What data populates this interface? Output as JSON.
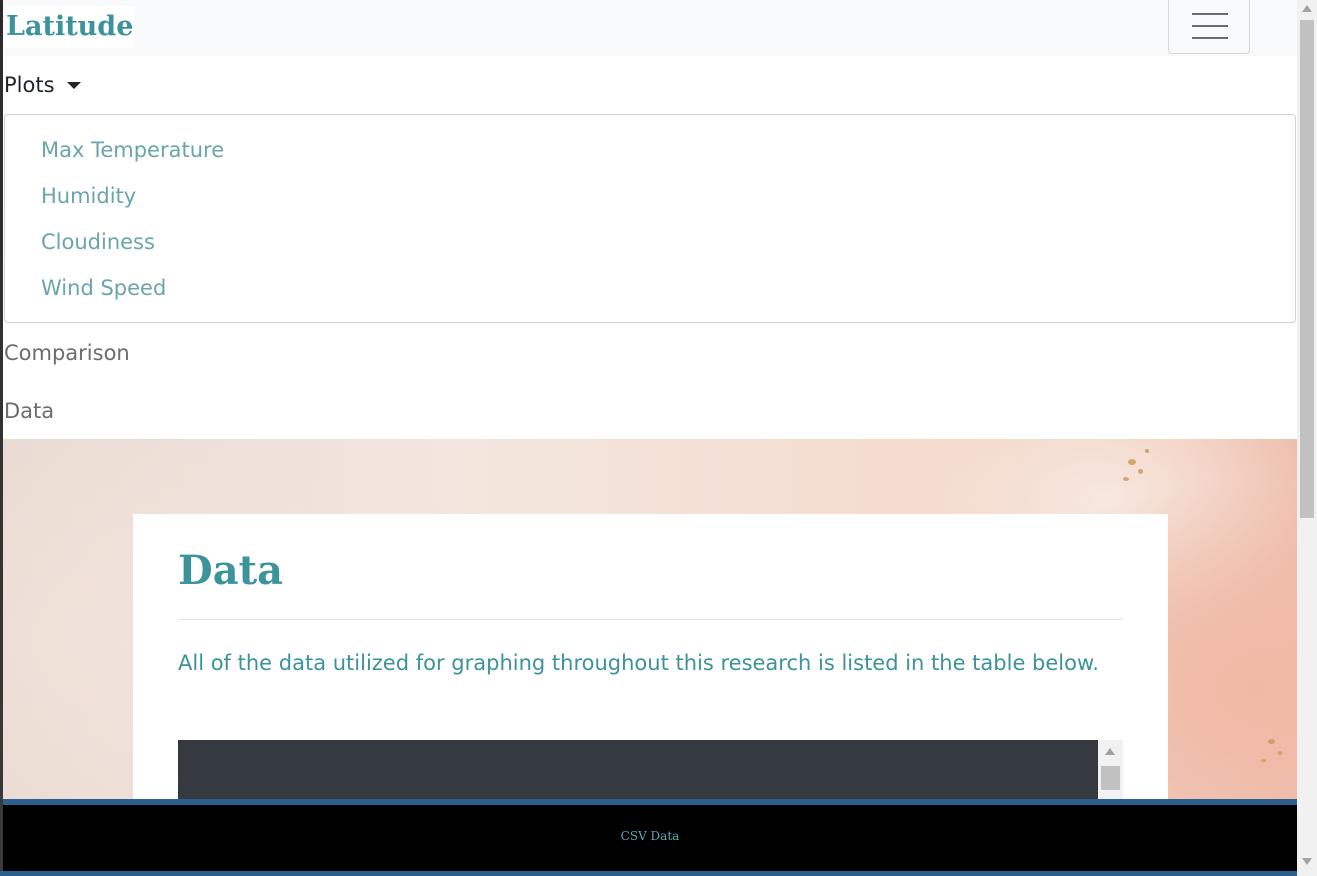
{
  "navbar": {
    "brand": "Latitude",
    "toggler_icon": "hamburger-menu-icon"
  },
  "nav": {
    "plots_label": "Plots",
    "plots_caret_icon": "caret-down-icon",
    "dropdown_items": [
      {
        "label": "Max Temperature"
      },
      {
        "label": "Humidity"
      },
      {
        "label": "Cloudiness"
      },
      {
        "label": "Wind Speed"
      }
    ],
    "comparison_label": "Comparison",
    "data_label": "Data"
  },
  "main": {
    "title": "Data",
    "description": "All of the data utilized for graphing throughout this research is listed in the table below."
  },
  "footer": {
    "link_label": "CSV Data"
  },
  "colors": {
    "accent": "#3c939b",
    "dropdown_link": "#6ba5ac",
    "footer_bg": "#000000",
    "table_header_bg": "#343a40"
  }
}
